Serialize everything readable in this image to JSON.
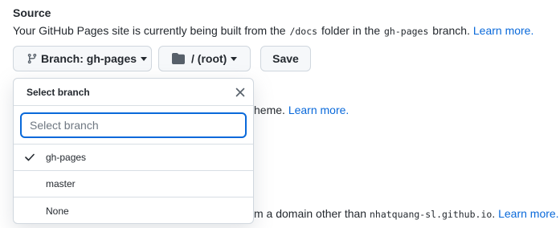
{
  "source": {
    "title": "Source",
    "desc_prefix": "Your GitHub Pages site is currently being built from the ",
    "folder_code": "/docs",
    "desc_middle": " folder in the ",
    "branch_code": "gh-pages",
    "desc_suffix": " branch. ",
    "learn_more": "Learn more."
  },
  "controls": {
    "branch_button": "Branch: gh-pages",
    "folder_button": "/ (root)",
    "save_button": "Save"
  },
  "background": {
    "theme_fragment": "heme. ",
    "theme_learn_more": "Learn more.",
    "domain_prefix": "m a domain other than ",
    "domain_code": "nhatquang-sl.github.io",
    "domain_suffix": ". ",
    "domain_learn_more": "Learn more."
  },
  "dropdown": {
    "title": "Select branch",
    "filter_placeholder": "Select branch",
    "filter_value": "",
    "items": [
      {
        "label": "gh-pages",
        "selected": true
      },
      {
        "label": "master",
        "selected": false
      },
      {
        "label": "None",
        "selected": false
      }
    ]
  },
  "icons": {
    "branch": "git-branch-icon",
    "caret": "caret-down-icon",
    "folder": "folder-icon",
    "close": "close-icon",
    "check": "check-icon"
  },
  "colors": {
    "link": "#0969da",
    "focus_border": "#0969da",
    "text": "#24292f",
    "button_bg": "#f6f8fa",
    "border": "#d0d7de"
  }
}
